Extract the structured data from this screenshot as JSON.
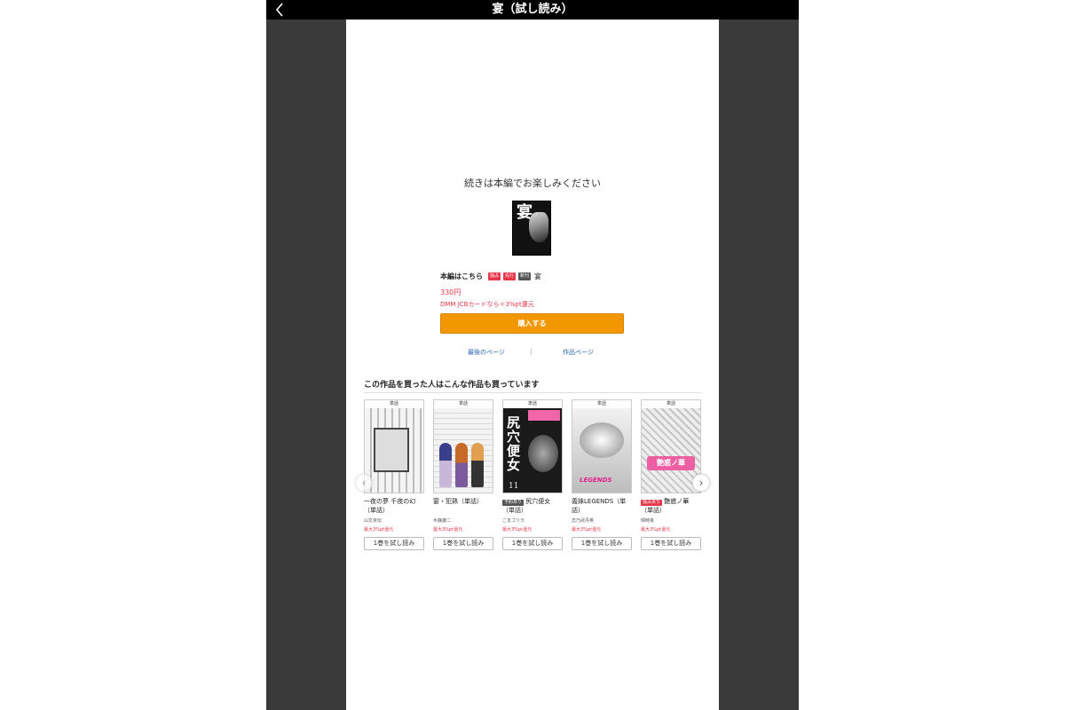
{
  "viewer": {
    "title": "宴（試し読み）",
    "back_icon": "chevron-left-icon"
  },
  "main": {
    "continue_message": "続きは本編でお楽しみください",
    "cover_kanji": "宴",
    "row_label": "本編はこちら",
    "badges": [
      "独占",
      "先行",
      "新刊"
    ],
    "work_title": "宴",
    "price": "330円",
    "promo": "DMM JCBカードなら＋3%pt還元",
    "buy_label": "購入する",
    "last_page_link": "最後のページ",
    "work_page_link": "作品ページ"
  },
  "recommend": {
    "heading": "この作品を買った人はこんな作品も買っています",
    "items": [
      {
        "tag": "単話",
        "title": "一夜の夢 千夜の幻（単話）",
        "badge": "",
        "author": "山文京伝",
        "point": "最大3%pt還元",
        "button": "1巻を試し読み"
      },
      {
        "tag": "単話",
        "title": "宴・犯熟（単話）",
        "badge": "",
        "author": "木静謙二",
        "point": "最大3%pt還元",
        "button": "1巻を試し読み"
      },
      {
        "tag": "単話",
        "title": "尻穴便女（単話）",
        "badge": "予約あり",
        "author": "ごまゴリラ",
        "point": "最大3%pt還元",
        "button": "1巻を試し読み",
        "cover_text": "尻穴便女",
        "cover_num": "11"
      },
      {
        "tag": "単話",
        "title": "義妹LEGENDS（単話）",
        "badge": "",
        "author": "志乃武丹英",
        "point": "最大3%pt還元",
        "button": "1巻を試し読み",
        "cover_logo": "LEGENDS"
      },
      {
        "tag": "単話",
        "title": "艶惑ノ華（単話）",
        "badge": "独占あり",
        "author": "晴時良",
        "point": "最大3%pt還元",
        "button": "1巻を試し読み",
        "cover_logo": "艶惑ノ華"
      }
    ],
    "prev_icon": "chevron-left-icon",
    "next_icon": "chevron-right-icon"
  },
  "colors": {
    "accent": "#f39700",
    "price": "#e8374b",
    "link": "#2868b6",
    "frame": "#3a3a3a"
  }
}
